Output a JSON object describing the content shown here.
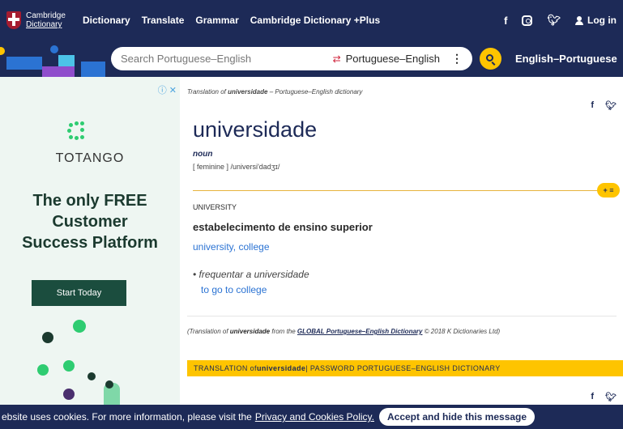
{
  "topnav": {
    "logo_line1": "Cambridge",
    "logo_line2": "Dictionary",
    "links": [
      "Dictionary",
      "Translate",
      "Grammar",
      "Cambridge Dictionary +Plus"
    ],
    "login": "Log in"
  },
  "search": {
    "placeholder": "Search Portuguese–English",
    "dictionary": "Portuguese–English",
    "swap_icon": "⇄",
    "other_direction": "English–Portuguese"
  },
  "ad": {
    "close": "ⓘ ✕",
    "brand": "TOTANGO",
    "headline_1": "The only FREE",
    "headline_2": "Customer",
    "headline_3": "Success Platform",
    "button": "Start Today"
  },
  "entry": {
    "translation_of_prefix": "Translation of ",
    "translation_of_word": "universidade",
    "translation_of_suffix": " – Portuguese–English dictionary",
    "headword": "universidade",
    "pos": "noun",
    "grammar": "[ feminine ] /universi'dadʒɪ/",
    "pill": "+ ≡",
    "guideword": "UNIVERSITY",
    "definition": "estabelecimento de ensino superior",
    "translations": "university, college",
    "example": "• frequentar a universidade",
    "example_translation": "to go to college",
    "credit_prefix": "(Translation of ",
    "credit_word": "universidade",
    "credit_mid": " from the ",
    "credit_dict": "GLOBAL Portuguese–English Dictionary",
    "credit_suffix": " © 2018 K Dictionaries Ltd)",
    "bar_prefix": "TRANSLATION of ",
    "bar_word": "universidade",
    "bar_suffix": " | PASSWORD PORTUGUESE–ENGLISH DICTIONARY"
  },
  "cookie": {
    "text": "ebsite uses cookies. For more information, please visit the",
    "link": "Privacy and Cookies Policy.",
    "button": "Accept and hide this message"
  },
  "colors": {
    "navy": "#1d2a57",
    "yellow": "#fec400",
    "link_blue": "#2b73d3",
    "ad_green": "#1b4d3e"
  }
}
